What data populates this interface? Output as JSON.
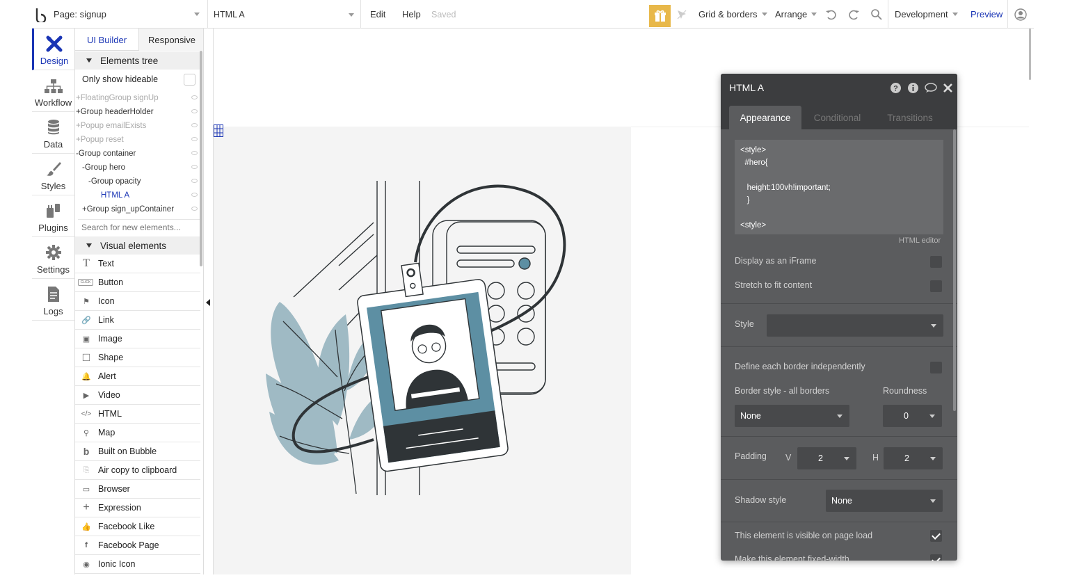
{
  "topbar": {
    "page_label": "Page: signup",
    "element_select": "HTML A",
    "edit": "Edit",
    "help": "Help",
    "saved": "Saved",
    "grid_borders": "Grid & borders",
    "arrange": "Arrange",
    "development": "Development",
    "preview": "Preview",
    "gift_color": "#e8b84a",
    "accent": "#1a35b5"
  },
  "leftnav": {
    "items": [
      {
        "label": "Design",
        "icon": "design-x-icon"
      },
      {
        "label": "Workflow",
        "icon": "workflow-icon"
      },
      {
        "label": "Data",
        "icon": "database-icon"
      },
      {
        "label": "Styles",
        "icon": "brush-icon"
      },
      {
        "label": "Plugins",
        "icon": "plug-icon"
      },
      {
        "label": "Settings",
        "icon": "gear-icon"
      },
      {
        "label": "Logs",
        "icon": "document-icon"
      }
    ]
  },
  "sidepanel": {
    "tab_ui_builder": "UI Builder",
    "tab_responsive": "Responsive",
    "elements_tree": "Elements tree",
    "only_show_hideable": "Only show hideable",
    "tree": [
      {
        "label": "FloatingGroup signUp",
        "prefix": "+"
      },
      {
        "label": "Group headerHolder",
        "prefix": "+"
      },
      {
        "label": "Popup emailExists",
        "prefix": "+"
      },
      {
        "label": "Popup reset",
        "prefix": "+"
      },
      {
        "label": "Group container",
        "prefix": "-"
      },
      {
        "label": "Group hero",
        "prefix": "-"
      },
      {
        "label": "Group opacity",
        "prefix": "-"
      },
      {
        "label": "HTML A",
        "prefix": ""
      },
      {
        "label": "Group sign_upContainer",
        "prefix": "+"
      }
    ],
    "search_placeholder": "Search for new elements...",
    "visual_elements": "Visual elements",
    "visual": [
      {
        "label": "Text",
        "icon": "T"
      },
      {
        "label": "Button",
        "icon": "CLICK"
      },
      {
        "label": "Icon",
        "icon": "⚑"
      },
      {
        "label": "Link",
        "icon": "🔗"
      },
      {
        "label": "Image",
        "icon": "▣"
      },
      {
        "label": "Shape",
        "icon": "□"
      },
      {
        "label": "Alert",
        "icon": "🔔"
      },
      {
        "label": "Video",
        "icon": "▶"
      },
      {
        "label": "HTML",
        "icon": "</>"
      },
      {
        "label": "Map",
        "icon": "⚲"
      },
      {
        "label": "Built on Bubble",
        "icon": "b"
      },
      {
        "label": "Air copy to clipboard",
        "icon": "⎘"
      },
      {
        "label": "Browser",
        "icon": "▭"
      },
      {
        "label": "Expression",
        "icon": "+"
      },
      {
        "label": "Facebook Like",
        "icon": "👍"
      },
      {
        "label": "Facebook Page",
        "icon": "f"
      },
      {
        "label": "Ionic Icon",
        "icon": "◉"
      }
    ]
  },
  "editor": {
    "title": "HTML A",
    "tab_appearance": "Appearance",
    "tab_conditional": "Conditional",
    "tab_transitions": "Transitions",
    "code": "<style>\n  #hero{\n\n   height:100vh!important;\n   }\n\n<style>",
    "html_editor": "HTML editor",
    "display_iframe": "Display as an iFrame",
    "stretch_fit": "Stretch to fit content",
    "style_label": "Style",
    "style_value": "",
    "define_border": "Define each border independently",
    "border_style_label": "Border style - all borders",
    "roundness_label": "Roundness",
    "border_style_value": "None",
    "roundness_value": "0",
    "padding_label": "Padding",
    "padding_v_label": "V",
    "padding_v": "2",
    "padding_h_label": "H",
    "padding_h": "2",
    "shadow_label": "Shadow style",
    "shadow_value": "None",
    "visible_on_load": "This element is visible on page load",
    "fixed_width": "Make this element fixed-width"
  }
}
